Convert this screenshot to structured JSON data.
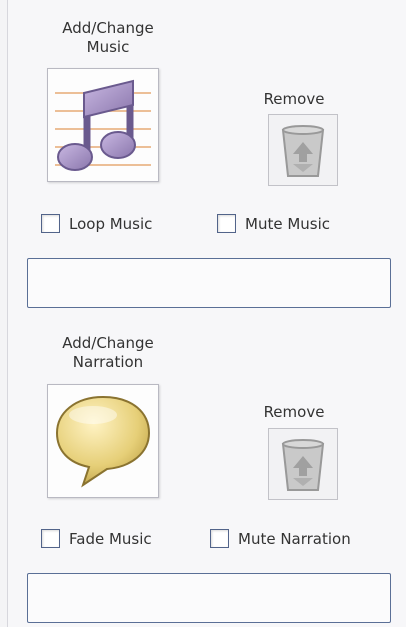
{
  "music": {
    "add_label": "Add/Change\nMusic",
    "remove_label": "Remove",
    "loop_label": "Loop Music",
    "mute_label": "Mute Music",
    "field_value": ""
  },
  "narration": {
    "add_label": "Add/Change\nNarration",
    "remove_label": "Remove",
    "fade_label": "Fade Music",
    "mute_label": "Mute Narration",
    "field_value": ""
  },
  "icons": {
    "music": "music-note-icon",
    "narration": "speech-bubble-icon",
    "remove": "recycle-bin-icon"
  }
}
